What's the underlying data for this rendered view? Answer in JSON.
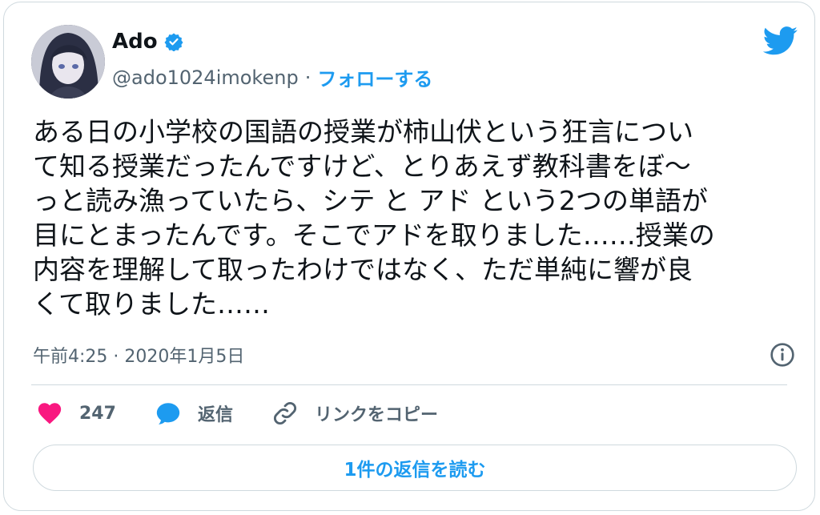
{
  "author": {
    "name": "Ado",
    "handle": "@ado1024imokenp",
    "follow_label": "フォローする"
  },
  "tweet": {
    "lines": [
      "ある日の小学校の国語の授業が柿山伏という狂言につい",
      "て知る授業だったんですけど、とりあえず教科書をぼ〜",
      "っと読み漁っていたら、シテ と アド という2つの単語が",
      "目にとまったんです。そこでアドを取りました……授業の",
      "内容を理解して取ったわけではなく、ただ単純に響が良",
      "くて取りました……"
    ],
    "timestamp": "午前4:25 · 2020年1月5日"
  },
  "actions": {
    "like_count": "247",
    "reply_label": "返信",
    "copy_link_label": "リンクをコピー"
  },
  "read_replies_label": "1件の返信を読む",
  "icons": {
    "verified": "verified-badge-icon",
    "twitter": "twitter-bird-icon",
    "info": "info-icon",
    "like": "heart-icon",
    "reply": "speech-bubble-icon",
    "link": "link-icon"
  },
  "colors": {
    "accent": "#1d9bf0",
    "like": "#f91880",
    "text": "#0f1419",
    "muted": "#536471",
    "border": "#cfd9de"
  }
}
